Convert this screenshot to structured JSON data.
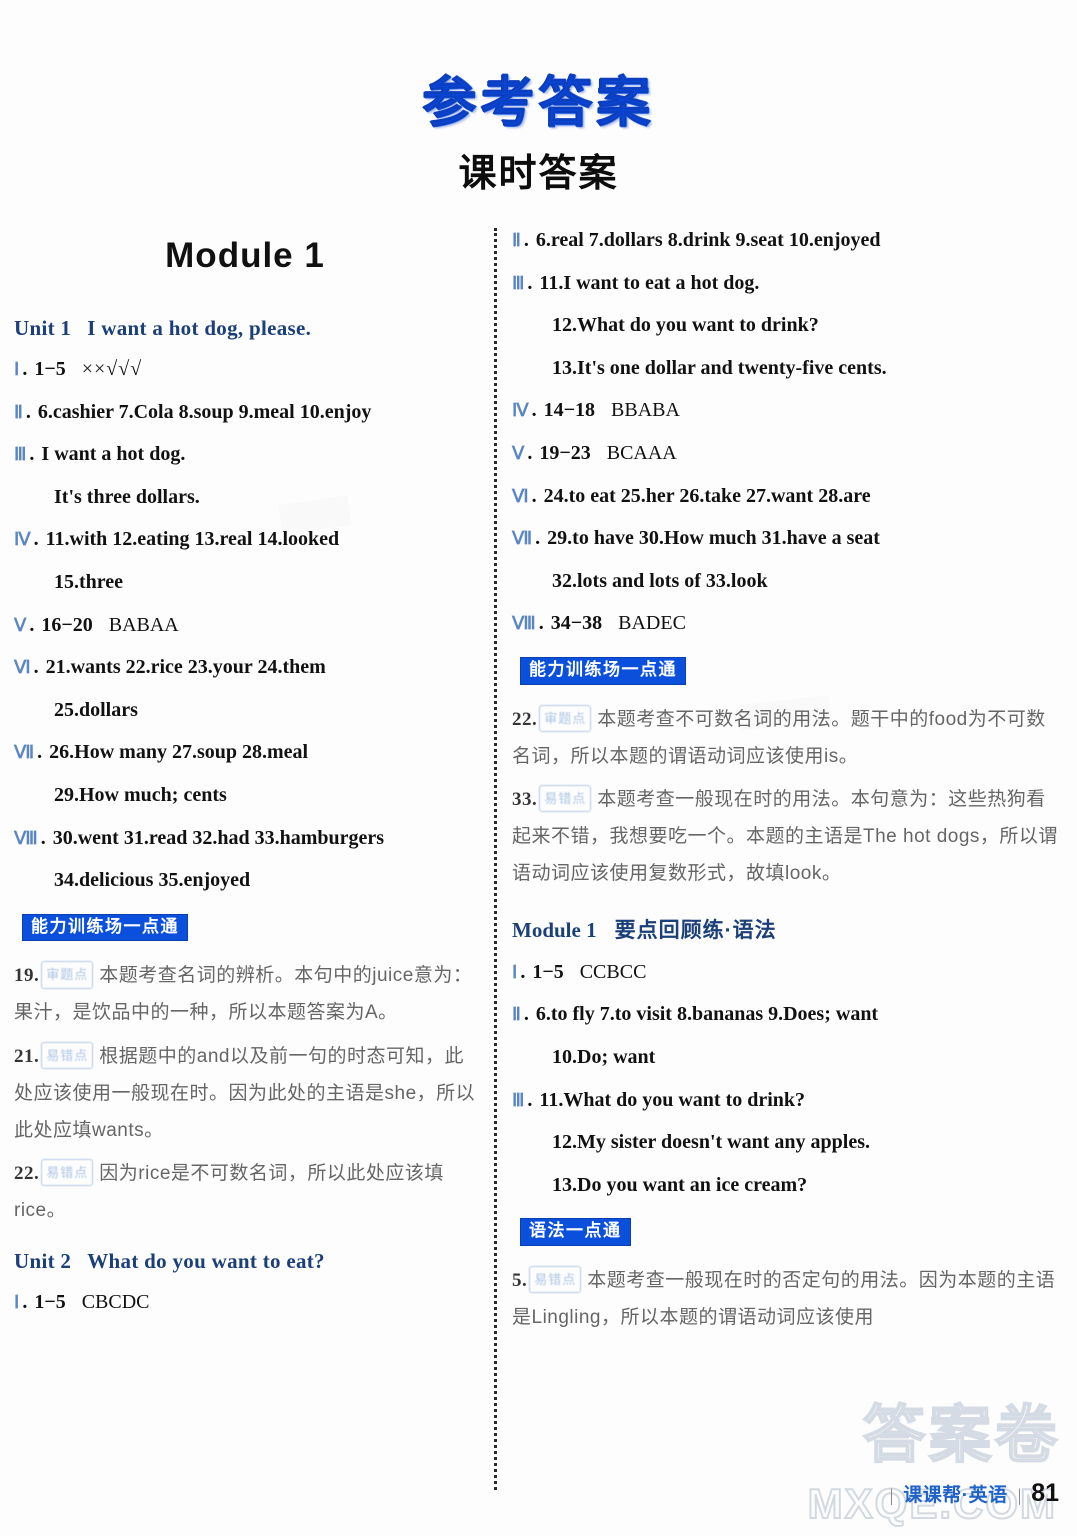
{
  "header": {
    "main_title": "参考答案",
    "sub_title": "课时答案"
  },
  "left_column": {
    "module_title": "Module 1",
    "unit1": {
      "label": "Unit 1",
      "title": "I want a hot dog, please."
    },
    "unit1_answers": [
      {
        "numeral": "Ⅰ",
        "range": "1−5",
        "answer": "××√√√",
        "style": "checks"
      },
      {
        "numeral": "Ⅱ",
        "items": "6.cashier   7.Cola   8.soup   9.meal   10.enjoy"
      },
      {
        "numeral": "Ⅲ",
        "items": "I want a hot dog."
      },
      {
        "numeral": "",
        "indent": true,
        "items": "It's three dollars."
      },
      {
        "numeral": "Ⅳ",
        "items": "11.with    12.eating   13.real   14.looked"
      },
      {
        "numeral": "",
        "indent": true,
        "items": "15.three"
      },
      {
        "numeral": "Ⅴ",
        "range": "16−20",
        "answer": "BABAA"
      },
      {
        "numeral": "Ⅵ",
        "items": "21.wants   22.rice   23.your   24.them"
      },
      {
        "numeral": "",
        "indent": true,
        "items": "25.dollars"
      },
      {
        "numeral": "Ⅶ",
        "items": "26.How many   27.soup   28.meal"
      },
      {
        "numeral": "",
        "indent": true,
        "items": "29.How much; cents"
      },
      {
        "numeral": "Ⅷ",
        "items": "30.went    31.read    32.had    33.hamburgers"
      },
      {
        "numeral": "",
        "indent": true,
        "items": "34.delicious    35.enjoyed"
      }
    ],
    "badge": "能力训练场一点通",
    "notes": [
      {
        "num": "19.",
        "tag": "审题点",
        "text": "本题考查名词的辨析。本句中的juice意为：果汁，是饮品中的一种，所以本题答案为A。"
      },
      {
        "num": "21.",
        "tag": "易错点",
        "text": "根据题中的and以及前一句的时态可知，此处应该使用一般现在时。因为此处的主语是she，所以此处应填wants。"
      },
      {
        "num": "22.",
        "tag": "易错点",
        "text": "因为rice是不可数名词，所以此处应该填rice。"
      }
    ],
    "unit2": {
      "label": "Unit 2",
      "title": "What do you want to eat?"
    },
    "unit2_answers": [
      {
        "numeral": "Ⅰ",
        "range": "1−5",
        "answer": "CBCDC"
      }
    ]
  },
  "right_column": {
    "unit2_answers": [
      {
        "numeral": "Ⅱ",
        "items": "6.real   7.dollars   8.drink   9.seat   10.enjoyed"
      },
      {
        "numeral": "Ⅲ",
        "items": "11.I want to eat a hot dog."
      },
      {
        "numeral": "",
        "indent": true,
        "items": "12.What do you want to drink?"
      },
      {
        "numeral": "",
        "indent": true,
        "items": "13.It's one dollar and twenty-five cents."
      },
      {
        "numeral": "Ⅳ",
        "range": "14−18",
        "answer": "BBABA"
      },
      {
        "numeral": "Ⅴ",
        "range": "19−23",
        "answer": "BCAAA"
      },
      {
        "numeral": "Ⅵ",
        "items": "24.to eat   25.her   26.take   27.want   28.are"
      },
      {
        "numeral": "Ⅶ",
        "items": "29.to have   30.How much   31.have a seat"
      },
      {
        "numeral": "",
        "indent": true,
        "items": "32.lots and lots of  33.look"
      },
      {
        "numeral": "Ⅷ",
        "range": "34−38",
        "answer": "BADEC"
      }
    ],
    "badge": "能力训练场一点通",
    "notes": [
      {
        "num": "22.",
        "tag": "审题点",
        "text": "本题考查不可数名词的用法。题干中的food为不可数名词，所以本题的谓语动词应该使用is。"
      },
      {
        "num": "33.",
        "tag": "易错点",
        "text": "本题考查一般现在时的用法。本句意为：这些热狗看起来不错，我想要吃一个。本题的主语是The hot dogs，所以谓语动词应该使用复数形式，故填look。"
      }
    ],
    "module_review": {
      "label": "Module 1",
      "title": "要点回顾练·语法"
    },
    "review_answers": [
      {
        "numeral": "Ⅰ",
        "range": "1−5",
        "answer": "CCBCC"
      },
      {
        "numeral": "Ⅱ",
        "items": "6.to fly   7.to visit   8.bananas   9.Does; want"
      },
      {
        "numeral": "",
        "indent": true,
        "items": "10.Do; want"
      },
      {
        "numeral": "Ⅲ",
        "items": "11.What do you want to drink?"
      },
      {
        "numeral": "",
        "indent": true,
        "items": "12.My sister doesn't want any apples."
      },
      {
        "numeral": "",
        "indent": true,
        "items": "13.Do you want an ice cream?"
      }
    ],
    "grammar_badge": "语法一点通",
    "grammar_notes": [
      {
        "num": "5.",
        "tag": "易错点",
        "text": "本题考查一般现在时的否定句的用法。因为本题的主语是Lingling，所以本题的谓语动词应该使用"
      }
    ]
  },
  "footer": {
    "bar": "|",
    "brand": "课课帮·英语",
    "separator": "|",
    "page_number": "81"
  },
  "watermarks": {
    "cn": "答案卷",
    "domain": "MXQE.COM"
  }
}
